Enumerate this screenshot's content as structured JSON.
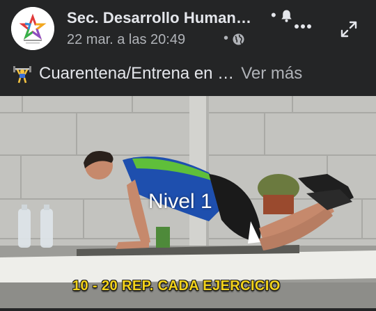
{
  "header": {
    "page_name": "Sec. Desarrollo Human…",
    "separator": "•",
    "timestamp": "22 mar. a las 20:49",
    "icons": {
      "avatar": "organization-logo",
      "notifications": "bell-icon",
      "more": "more-options-icon",
      "audience": "globe-icon",
      "expand": "expand-icon"
    }
  },
  "caption": {
    "emoji": "weightlifter-icon",
    "text": "Cuarentena/Entrena en …",
    "see_more": "Ver más"
  },
  "video": {
    "overlay_level": "Nivel 1",
    "overlay_reps": "10 - 20 REP.  CADA EJERCICIO"
  },
  "colors": {
    "background": "#242526",
    "primary_text": "#e4e6eb",
    "secondary_text": "#b0b3b8",
    "reps_text": "#f2d21b"
  }
}
